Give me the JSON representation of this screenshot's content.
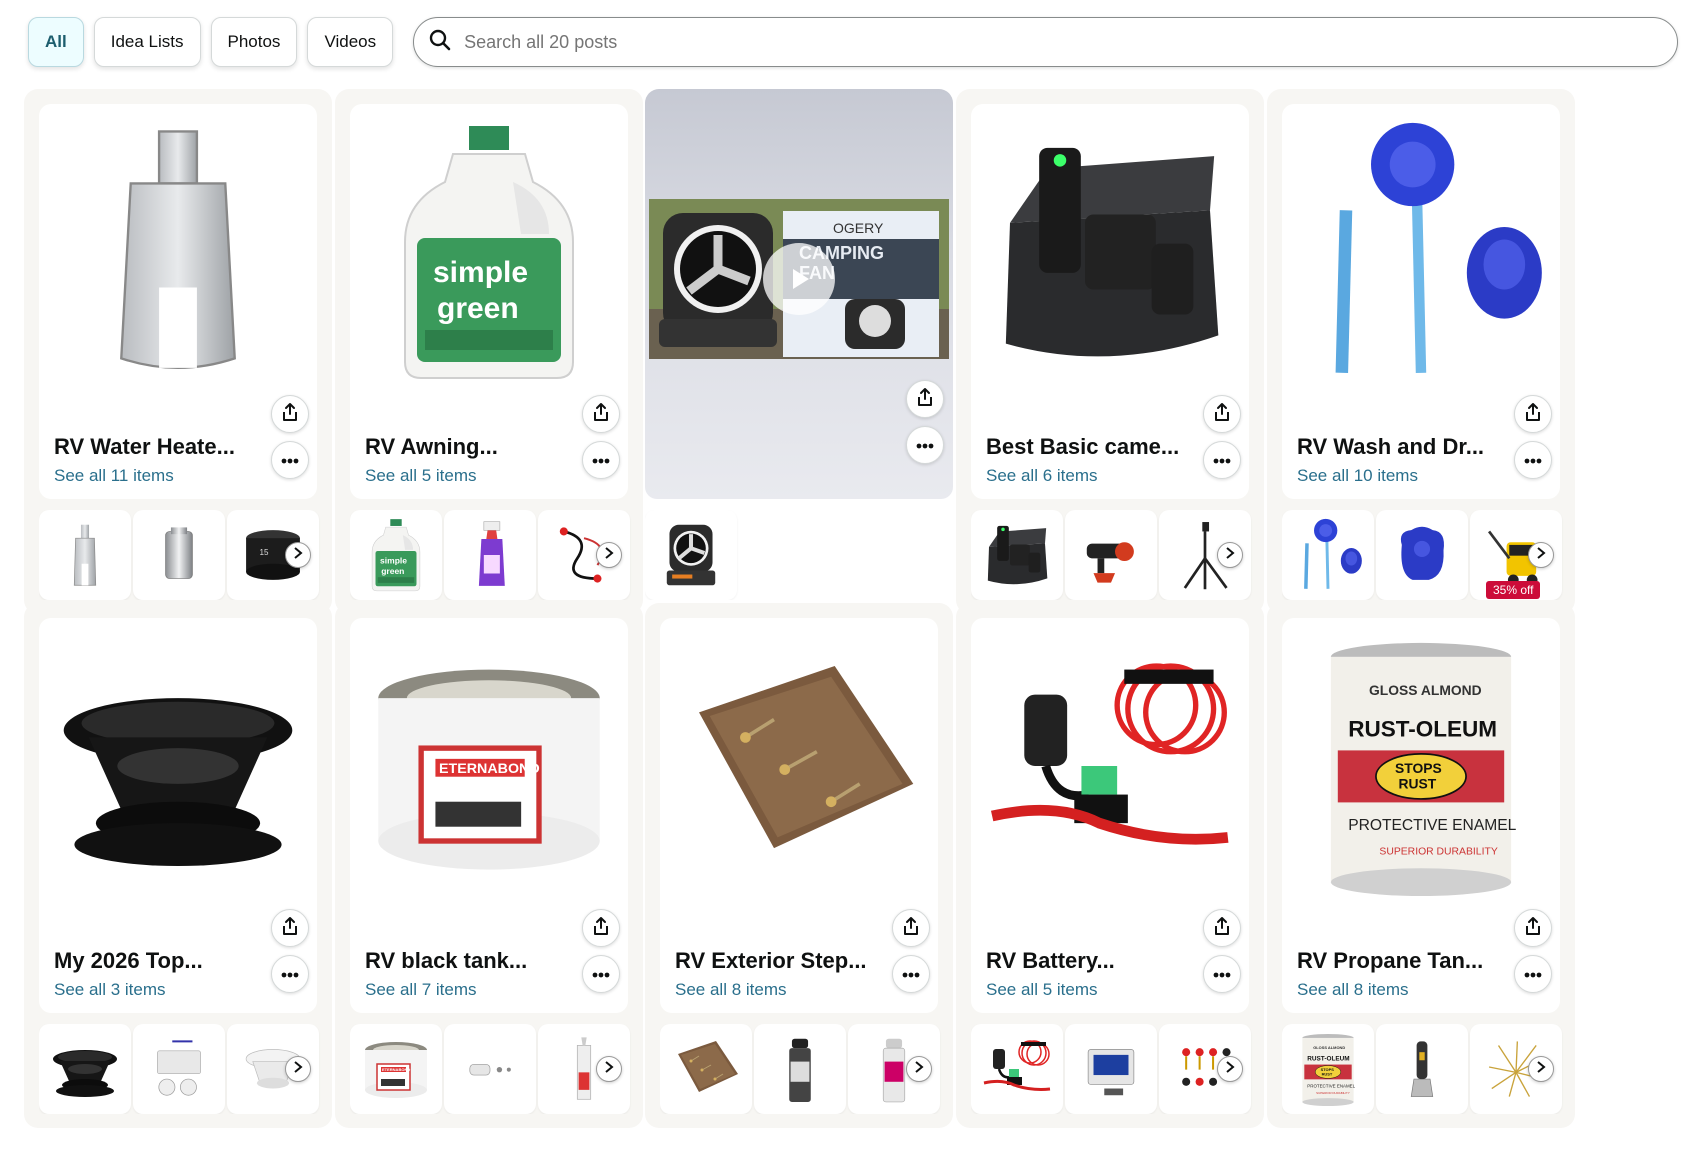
{
  "filters": [
    "All",
    "Idea Lists",
    "Photos",
    "Videos"
  ],
  "search": {
    "placeholder": "Search all 20 posts"
  },
  "cards": [
    {
      "title": "RV Water Heate...",
      "sub": "See all 11 items",
      "hero": "anode-rod-socket",
      "thumbs": [
        "socket-tool",
        "chrome-socket",
        "impact-socket"
      ],
      "arrow": true
    },
    {
      "title": "RV Awning...",
      "sub": "See all 5 items",
      "hero": "cleaner-jug",
      "thumbs": [
        "cleaner-jug",
        "spray-bottle",
        "cable-kit"
      ],
      "arrow": true
    },
    {
      "title": "",
      "sub": "",
      "video": true,
      "hero": "camping-fan",
      "thumbs": [
        "camping-fan"
      ],
      "arrow": false
    },
    {
      "title": "Best Basic came...",
      "sub": "See all 6 items",
      "hero": "mic-case",
      "thumbs": [
        "mic-case",
        "shotgun-mic",
        "tripod"
      ],
      "arrow": true
    },
    {
      "title": "RV Wash and Dr...",
      "sub": "See all 10 items",
      "hero": "wash-brush",
      "thumbs": [
        "wash-brush",
        "mitt",
        "pressure-washer"
      ],
      "arrow": true,
      "badge": "35% off"
    },
    {
      "title": "My 2026 Top...",
      "sub": "See all 3 items",
      "hero": "vent-cap",
      "thumbs": [
        "vent-cap",
        "light-kit",
        "white-cap"
      ],
      "arrow": true
    },
    {
      "title": "RV black tank...",
      "sub": "See all 7 items",
      "hero": "tape-roll",
      "thumbs": [
        "tape-roll",
        "small-parts",
        "caulk-tube"
      ],
      "arrow": true
    },
    {
      "title": "RV Exterior Step...",
      "sub": "See all 8 items",
      "hero": "step-rug",
      "thumbs": [
        "step-rug",
        "spray-can",
        "spray-can-2"
      ],
      "arrow": true
    },
    {
      "title": "RV Battery...",
      "sub": "See all 5 items",
      "hero": "fuse-holder",
      "thumbs": [
        "fuse-holder",
        "meter",
        "terminals"
      ],
      "arrow": true
    },
    {
      "title": "RV Propane Tan...",
      "sub": "See all 8 items",
      "hero": "paint-can",
      "thumbs": [
        "paint-can",
        "scraper",
        "brass-ties"
      ],
      "arrow": true
    }
  ],
  "paint": {
    "top": "GLOSS ALMOND",
    "brand": "RUST-OLEUM",
    "seal": "STOPS RUST",
    "line": "PROTECTIVE ENAMEL"
  },
  "tape": {
    "brand": "ETERNABOND"
  },
  "cleaner": {
    "brand1": "simple",
    "brand2": "green"
  },
  "fan": {
    "brand": "OGERY",
    "text": "CAMPING FAN"
  },
  "colors": {
    "link": "#2a6f8c",
    "card_bg": "#f7f6f3",
    "badge": "#cc0c39",
    "active_pill": "#edfdff"
  }
}
